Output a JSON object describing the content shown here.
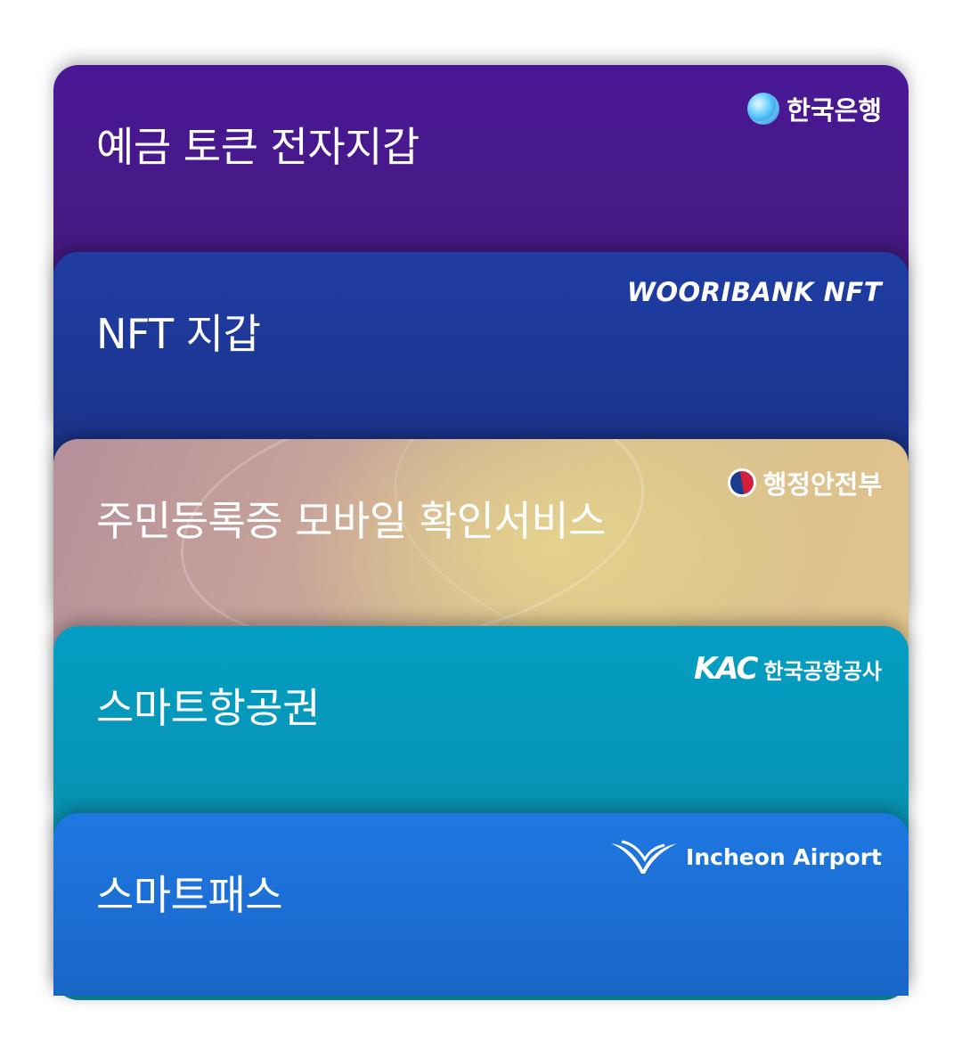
{
  "cards": [
    {
      "title": "예금 토큰 전자지갑",
      "logo_text": "한국은행",
      "logo_icon": "bank-of-korea-logo-icon",
      "color": "#4a1796"
    },
    {
      "title": "NFT 지갑",
      "logo_text": "WOORIBANK NFT",
      "color": "#1f3da4"
    },
    {
      "title": "주민등록증 모바일 확인서비스",
      "logo_text": "행정안전부",
      "logo_icon": "korea-government-emblem-icon",
      "color": "#d8c18e"
    },
    {
      "title": "스마트항공권",
      "logo_mark": "KAC",
      "logo_text": "한국공항공사",
      "color": "#039ec2"
    },
    {
      "title": "스마트패스",
      "logo_text": "Incheon Airport",
      "logo_icon": "incheon-airport-logo-icon",
      "color": "#1f78e2"
    }
  ]
}
